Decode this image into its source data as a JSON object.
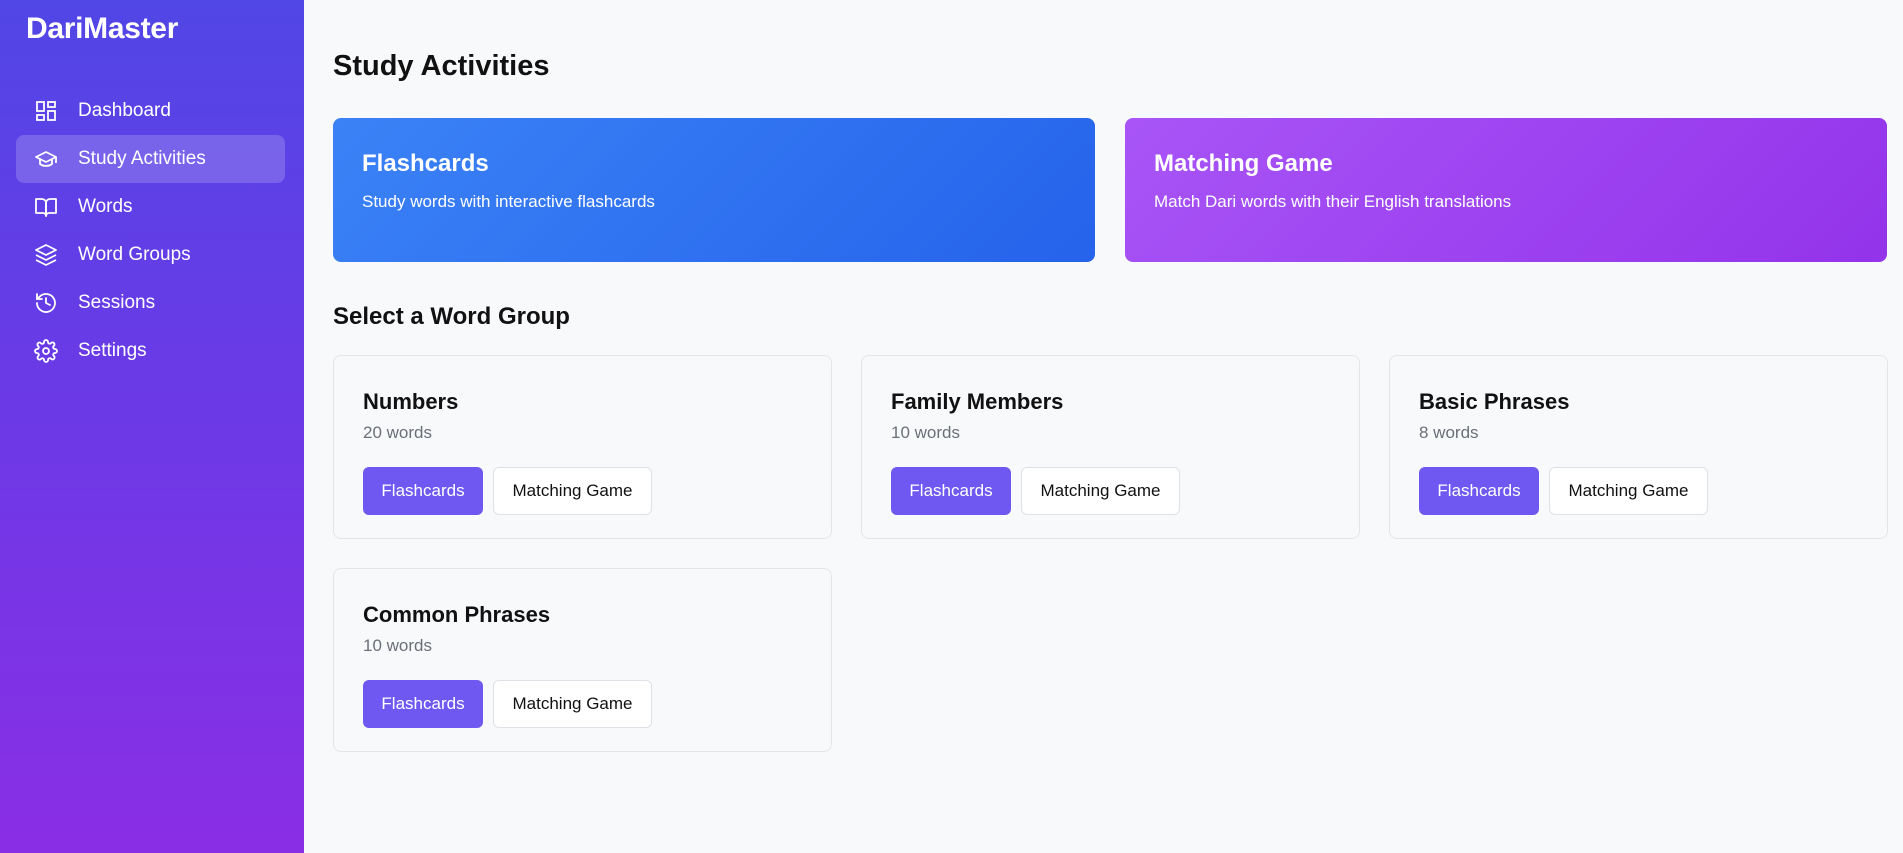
{
  "app": {
    "brand": "DariMaster"
  },
  "sidebar": {
    "items": [
      {
        "label": "Dashboard",
        "icon": "dashboard-icon"
      },
      {
        "label": "Study Activities",
        "icon": "graduation-cap-icon",
        "active": true
      },
      {
        "label": "Words",
        "icon": "book-icon"
      },
      {
        "label": "Word Groups",
        "icon": "layers-icon"
      },
      {
        "label": "Sessions",
        "icon": "history-icon"
      },
      {
        "label": "Settings",
        "icon": "gear-icon"
      }
    ]
  },
  "main": {
    "title": "Study Activities",
    "activities": [
      {
        "title": "Flashcards",
        "description": "Study words with interactive flashcards",
        "color": "#3b82f6"
      },
      {
        "title": "Matching Game",
        "description": "Match Dari words with their English translations",
        "color": "#a855f7"
      }
    ],
    "groups_title": "Select a Word Group",
    "groups": [
      {
        "name": "Numbers",
        "count": "20 words",
        "primary": "Flashcards",
        "secondary": "Matching Game"
      },
      {
        "name": "Family Members",
        "count": "10 words",
        "primary": "Flashcards",
        "secondary": "Matching Game"
      },
      {
        "name": "Basic Phrases",
        "count": "8 words",
        "primary": "Flashcards",
        "secondary": "Matching Game"
      },
      {
        "name": "Common Phrases",
        "count": "10 words",
        "primary": "Flashcards",
        "secondary": "Matching Game"
      }
    ]
  },
  "colors": {
    "sidebar_start": "#5146e6",
    "sidebar_end": "#8a2ee5",
    "primary_button": "#6e58f1"
  }
}
